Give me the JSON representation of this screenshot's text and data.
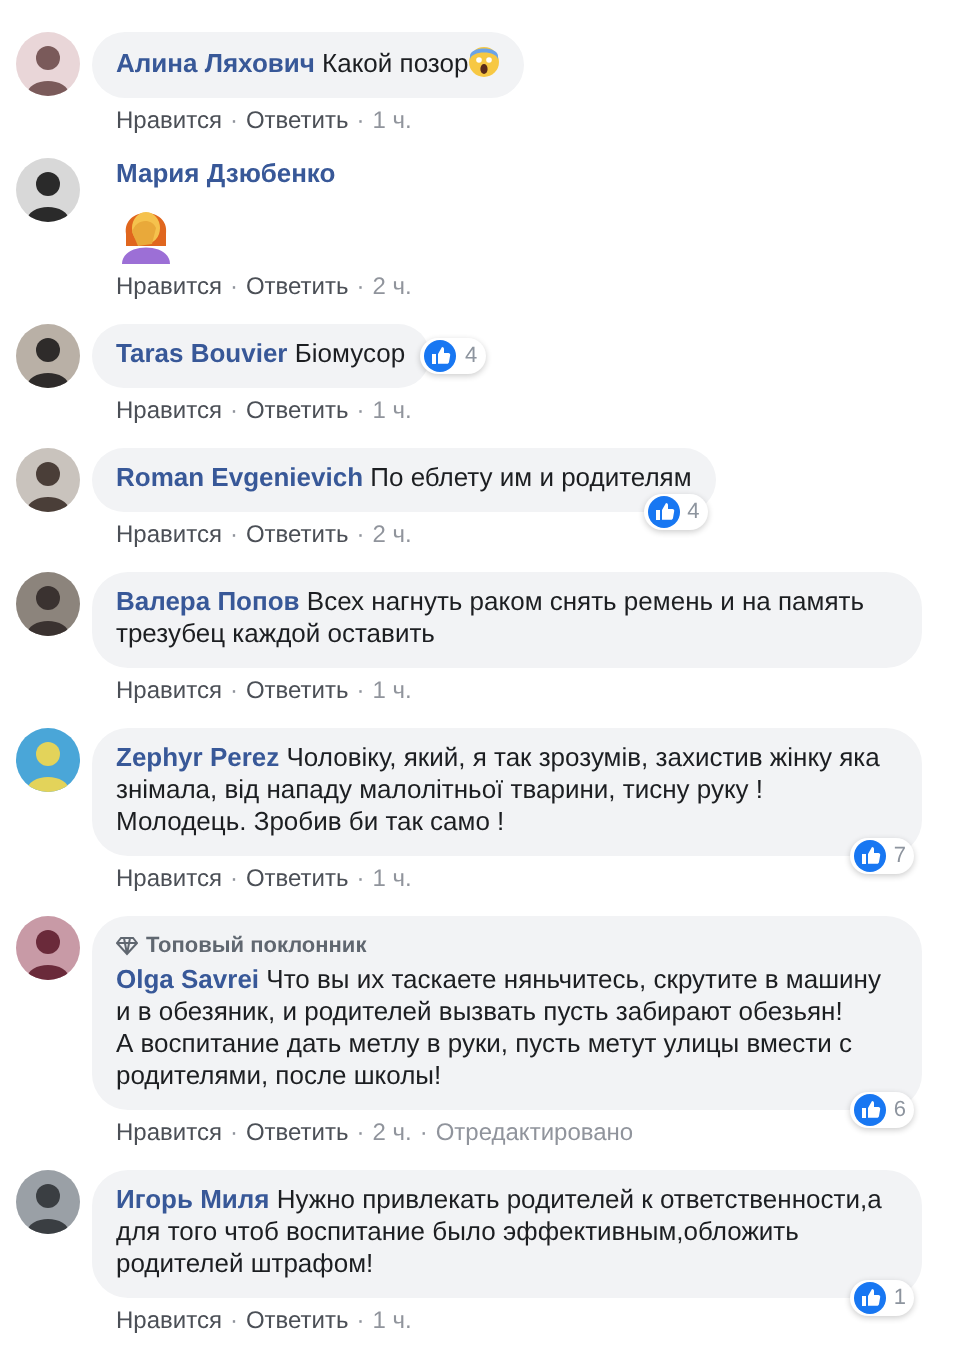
{
  "separator": "·",
  "comments": [
    {
      "kind": "bubble",
      "name": "Алина Ляхович",
      "text": "Какой позор",
      "emoji_after": true,
      "like_label": "Нравится",
      "reply_label": "Ответить",
      "time": "1 ч."
    },
    {
      "kind": "sticker",
      "name": "Мария Дзюбенко",
      "emoji_after": false,
      "like_label": "Нравится",
      "reply_label": "Ответить",
      "time": "2 ч."
    },
    {
      "kind": "bubble",
      "name": "Taras Bouvier",
      "text": "Біомусор",
      "emoji_after": false,
      "likes": "4",
      "like_label": "Нравится",
      "reply_label": "Ответить",
      "time": "1 ч."
    },
    {
      "kind": "bubble",
      "name": "Roman Evgenievich",
      "text": "По еблету им и родителям",
      "emoji_after": false,
      "likes": "4",
      "like_label": "Нравится",
      "reply_label": "Ответить",
      "time": "2 ч."
    },
    {
      "kind": "bubble",
      "name": "Валера Попов",
      "text": "Всех нагнуть раком снять ремень и на память трезубец каждой оставить",
      "emoji_after": false,
      "like_label": "Нравится",
      "reply_label": "Ответить",
      "time": "1 ч."
    },
    {
      "kind": "bubble",
      "name": "Zephyr Perez",
      "text": "Чоловіку, який, я так зрозумів, захистив жінку яка знімала, від нападу малолітньої тварини, тисну руку ! Молодець. Зробив би так само !",
      "emoji_after": false,
      "likes": "7",
      "like_label": "Нравится",
      "reply_label": "Ответить",
      "time": "1 ч."
    },
    {
      "kind": "bubble",
      "badge": "Топовый поклонник",
      "name": "Olga Savrei",
      "text": "Что вы их таскаете няньчитесь, скрутите в машину и в обезяник, и родителей вызвать пусть забирают обезьян!\nА воспитание дать метлу в руки, пусть метут улицы вмести с родителями, после школы!",
      "emoji_after": false,
      "likes": "6",
      "like_label": "Нравится",
      "reply_label": "Ответить",
      "time": "2 ч.",
      "edited": "Отредактировано"
    },
    {
      "kind": "bubble",
      "name": "Игорь Миля",
      "text": "Нужно привлекать родителей к ответственности,а для того чтоб воспитание было эффективным,обложить родителей штрафом!",
      "emoji_after": false,
      "likes": "1",
      "like_label": "Нравится",
      "reply_label": "Ответить",
      "time": "1 ч."
    }
  ]
}
